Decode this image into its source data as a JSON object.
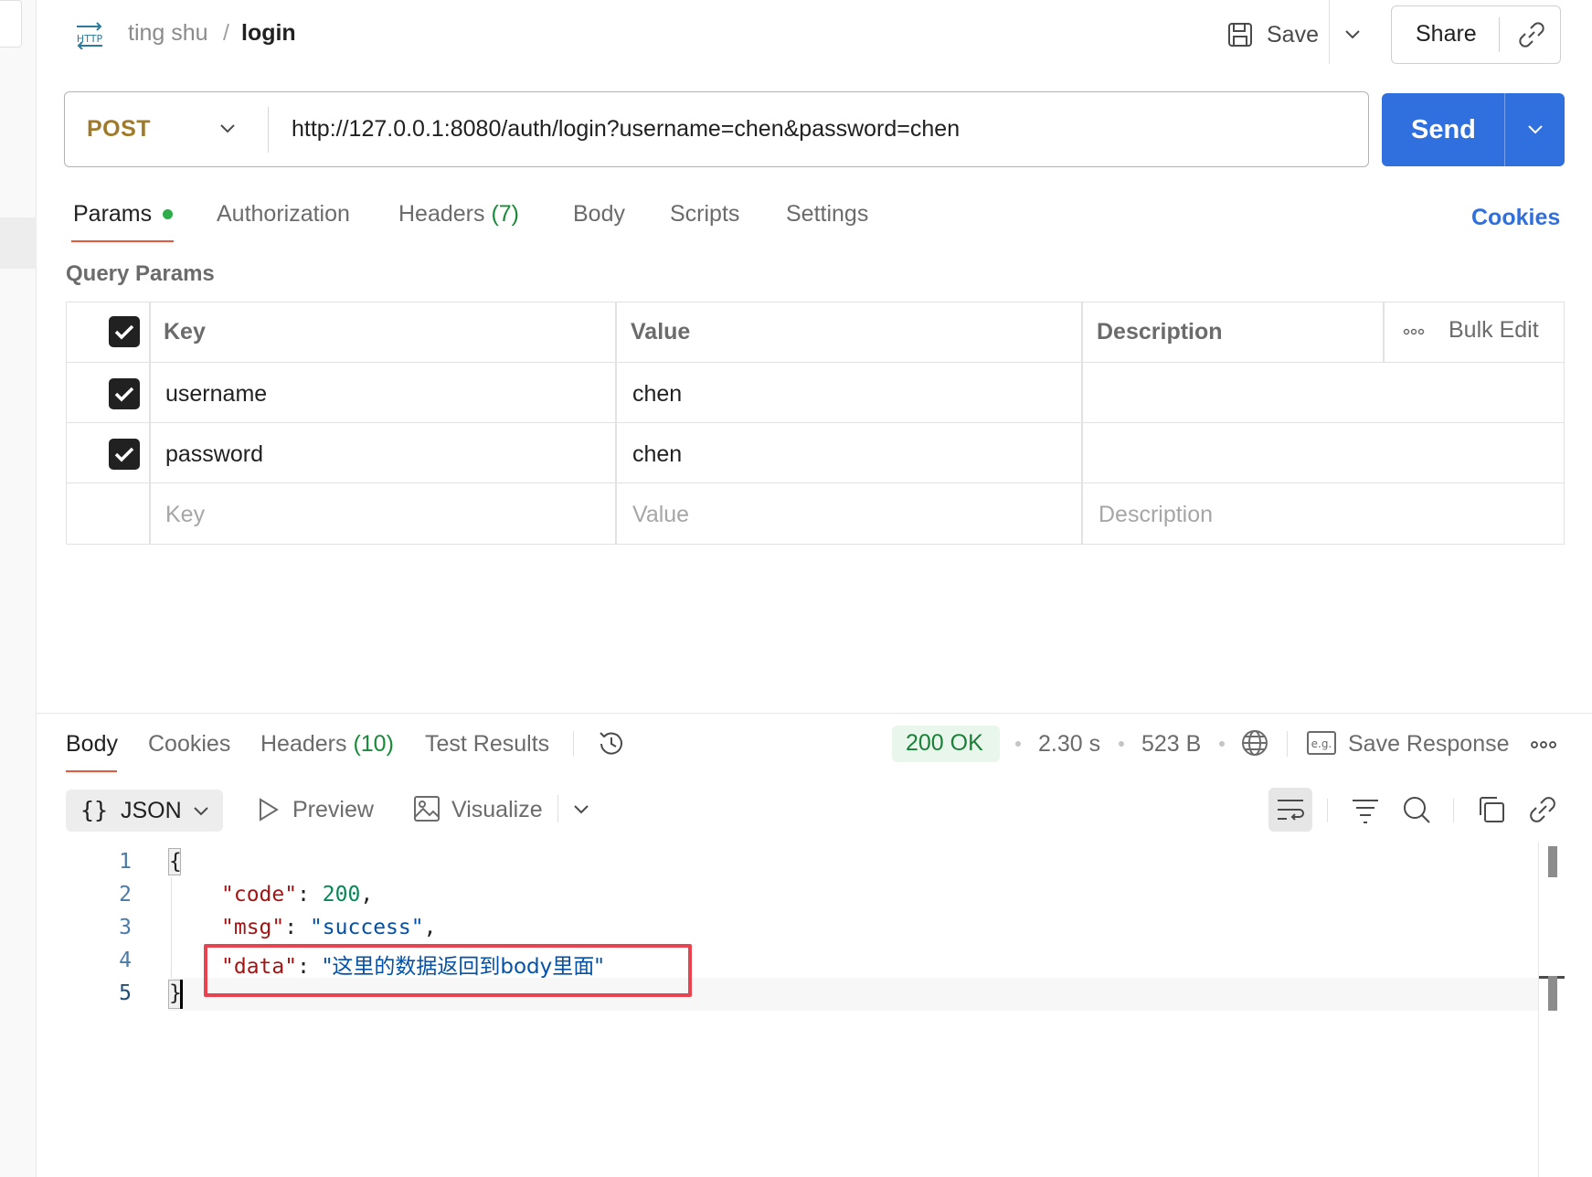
{
  "header": {
    "http_badge": "HTTP",
    "collection": "ting shu",
    "separator": "/",
    "request_name": "login",
    "save_label": "Save",
    "share_label": "Share"
  },
  "request": {
    "method": "POST",
    "url": "http://127.0.0.1:8080/auth/login?username=chen&password=chen",
    "send_label": "Send"
  },
  "request_tabs": {
    "params": "Params",
    "authorization": "Authorization",
    "headers": "Headers",
    "headers_count": "(7)",
    "body": "Body",
    "scripts": "Scripts",
    "settings": "Settings",
    "cookies": "Cookies"
  },
  "query_params": {
    "title": "Query Params",
    "headers": {
      "key": "Key",
      "value": "Value",
      "description": "Description",
      "bulk_edit": "Bulk Edit"
    },
    "rows": [
      {
        "key": "username",
        "value": "chen",
        "description": "",
        "checked": true
      },
      {
        "key": "password",
        "value": "chen",
        "description": "",
        "checked": true
      }
    ],
    "placeholders": {
      "key": "Key",
      "value": "Value",
      "description": "Description"
    }
  },
  "response": {
    "tabs": {
      "body": "Body",
      "cookies": "Cookies",
      "headers": "Headers",
      "headers_count": "(10)",
      "test_results": "Test Results"
    },
    "status": "200 OK",
    "time": "2.30 s",
    "size": "523 B",
    "save_response": "Save Response",
    "format": "JSON",
    "preview": "Preview",
    "visualize": "Visualize",
    "line_numbers": [
      "1",
      "2",
      "3",
      "4",
      "5"
    ],
    "json": {
      "open": "{",
      "close": "}",
      "code_key": "\"code\"",
      "code_val": "200",
      "msg_key": "\"msg\"",
      "msg_val": "\"success\"",
      "data_key": "\"data\"",
      "data_val": "\"这里的数据返回到body里面\""
    }
  },
  "colors": {
    "accent": "#2f6fde",
    "method": "#a07a2b",
    "status_ok": "#1a7f37",
    "highlight": "#e8434f"
  }
}
